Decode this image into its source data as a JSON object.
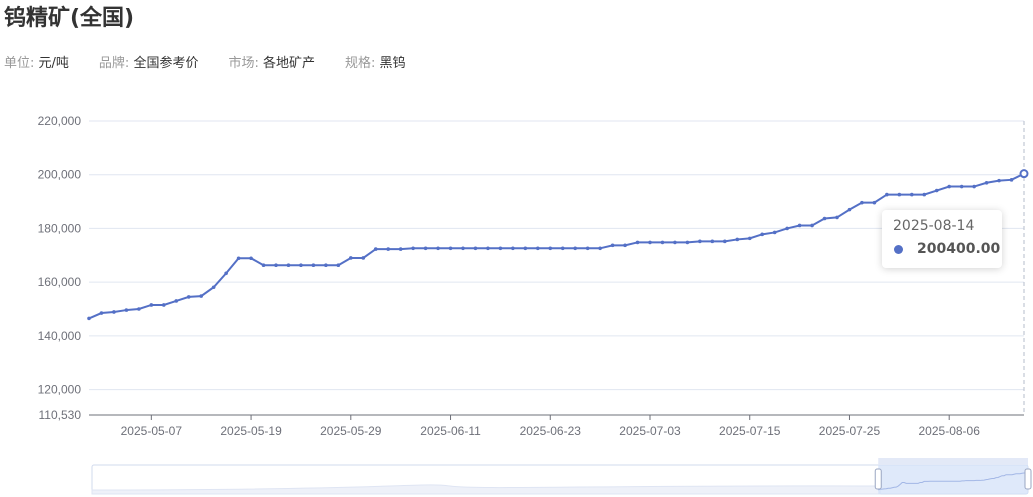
{
  "header": {
    "title": "钨精矿(全国)",
    "meta": [
      {
        "key": "单位:",
        "value": "元/吨"
      },
      {
        "key": "品牌:",
        "value": "全国参考价"
      },
      {
        "key": "市场:",
        "value": "各地矿产"
      },
      {
        "key": "规格:",
        "value": "黑钨"
      }
    ]
  },
  "tooltip": {
    "date": "2025-08-14",
    "value": "200400.00"
  },
  "colors": {
    "line": "#5470c6",
    "grid": "#e0e6f1",
    "zoom_fill": "#d2dff8"
  },
  "chart_data": {
    "type": "line",
    "title": "钨精矿(全国)",
    "ylabel": "元/吨",
    "ylim": [
      110530,
      220000
    ],
    "yticks": [
      110530,
      120000,
      140000,
      160000,
      180000,
      200000,
      220000
    ],
    "ytick_labels": [
      "110,530",
      "120,000",
      "140,000",
      "160,000",
      "180,000",
      "200,000",
      "220,000"
    ],
    "xtick_labels": [
      "2025-05-07",
      "2025-05-19",
      "2025-05-29",
      "2025-06-11",
      "2025-06-23",
      "2025-07-03",
      "2025-07-15",
      "2025-07-25",
      "2025-08-06"
    ],
    "grid": true,
    "x": [
      "2025-04-27",
      "2025-04-28",
      "2025-04-29",
      "2025-04-30",
      "2025-05-06",
      "2025-05-07",
      "2025-05-08",
      "2025-05-09",
      "2025-05-12",
      "2025-05-13",
      "2025-05-14",
      "2025-05-15",
      "2025-05-16",
      "2025-05-19",
      "2025-05-20",
      "2025-05-21",
      "2025-05-22",
      "2025-05-23",
      "2025-05-26",
      "2025-05-27",
      "2025-05-28",
      "2025-05-29",
      "2025-05-30",
      "2025-06-03",
      "2025-06-04",
      "2025-06-05",
      "2025-06-06",
      "2025-06-09",
      "2025-06-10",
      "2025-06-11",
      "2025-06-12",
      "2025-06-13",
      "2025-06-16",
      "2025-06-17",
      "2025-06-18",
      "2025-06-19",
      "2025-06-20",
      "2025-06-23",
      "2025-06-24",
      "2025-06-25",
      "2025-06-26",
      "2025-06-27",
      "2025-06-30",
      "2025-07-01",
      "2025-07-02",
      "2025-07-03",
      "2025-07-04",
      "2025-07-07",
      "2025-07-08",
      "2025-07-09",
      "2025-07-10",
      "2025-07-11",
      "2025-07-14",
      "2025-07-15",
      "2025-07-16",
      "2025-07-17",
      "2025-07-18",
      "2025-07-21",
      "2025-07-22",
      "2025-07-23",
      "2025-07-24",
      "2025-07-25",
      "2025-07-28",
      "2025-07-29",
      "2025-07-30",
      "2025-07-31",
      "2025-08-01",
      "2025-08-04",
      "2025-08-05",
      "2025-08-06",
      "2025-08-07",
      "2025-08-08",
      "2025-08-11",
      "2025-08-12",
      "2025-08-13",
      "2025-08-14"
    ],
    "series": [
      {
        "name": "钨精矿(全国)",
        "values": [
          146500,
          148500,
          148900,
          149600,
          150000,
          151500,
          151500,
          153000,
          154500,
          154800,
          158100,
          163300,
          168900,
          168900,
          166300,
          166300,
          166300,
          166300,
          166300,
          166300,
          166300,
          169000,
          169000,
          172300,
          172300,
          172300,
          172600,
          172600,
          172600,
          172600,
          172600,
          172600,
          172600,
          172600,
          172600,
          172600,
          172600,
          172600,
          172600,
          172600,
          172600,
          172600,
          173700,
          173700,
          174800,
          174800,
          174800,
          174800,
          174800,
          175200,
          175200,
          175200,
          175900,
          176300,
          177800,
          178500,
          180000,
          181100,
          181100,
          183700,
          184100,
          187000,
          189600,
          189600,
          192600,
          192600,
          192600,
          192600,
          194100,
          195600,
          195600,
          195600,
          197000,
          197800,
          198100,
          200400
        ]
      }
    ],
    "highlighted_point": {
      "x": "2025-08-14",
      "y": 200400
    },
    "data_zoom": {
      "start_percent": 84,
      "end_percent": 100
    }
  }
}
